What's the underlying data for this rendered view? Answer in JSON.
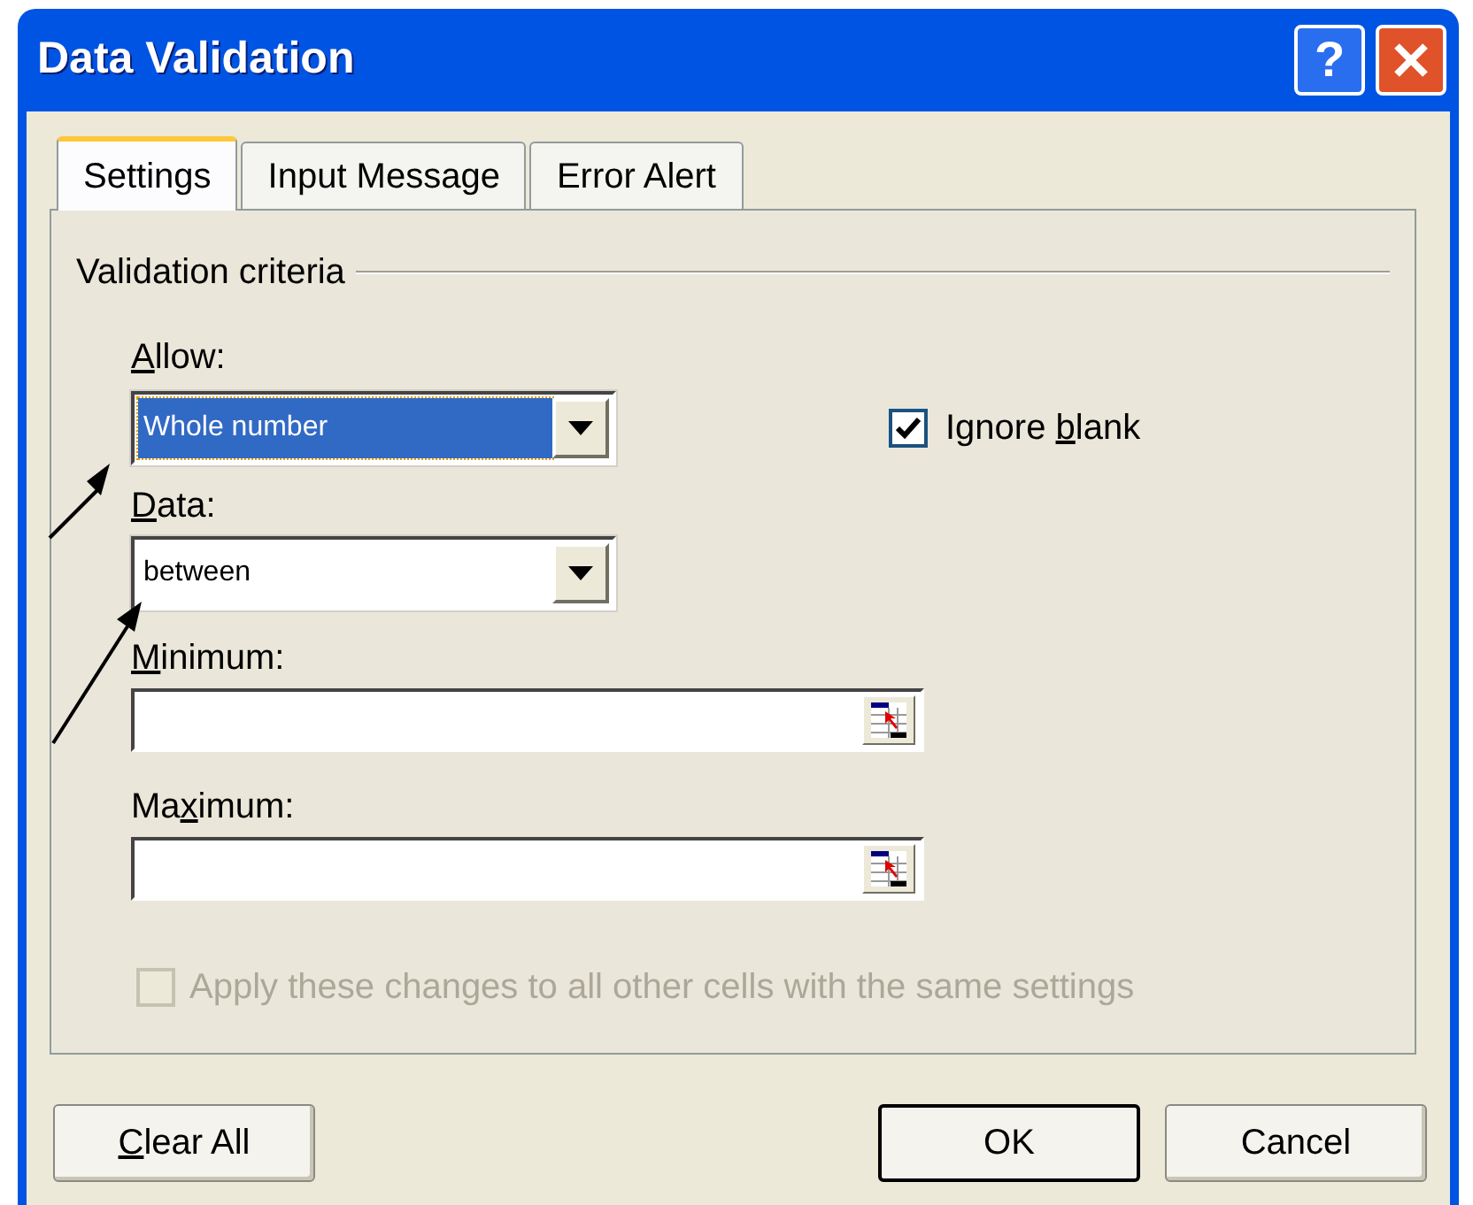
{
  "window": {
    "title": "Data Validation",
    "help_button": "?"
  },
  "tabs": [
    {
      "label": "Settings",
      "selected": true
    },
    {
      "label": "Input Message",
      "selected": false
    },
    {
      "label": "Error Alert",
      "selected": false
    }
  ],
  "criteria": {
    "title": "Validation criteria",
    "allow": {
      "label": [
        {
          "text": "A",
          "underlined": true
        },
        {
          "text": "llow:",
          "underlined": false
        }
      ],
      "value": "Whole number",
      "focused": true
    },
    "ignore_blank": {
      "label": [
        {
          "text": "Ignore ",
          "underlined": false
        },
        {
          "text": "b",
          "underlined": true
        },
        {
          "text": "lank",
          "underlined": false
        }
      ],
      "checked": true
    },
    "data": {
      "label": [
        {
          "text": "D",
          "underlined": true
        },
        {
          "text": "ata:",
          "underlined": false
        }
      ],
      "value": "between",
      "focused": false
    },
    "minimum": {
      "label": [
        {
          "text": "M",
          "underlined": true
        },
        {
          "text": "inimum:",
          "underlined": false
        }
      ]
    },
    "maximum": {
      "label": [
        {
          "text": "Ma",
          "underlined": false
        },
        {
          "text": "x",
          "underlined": true
        },
        {
          "text": "imum:",
          "underlined": false
        }
      ]
    }
  },
  "apply_all": {
    "label": "Apply these changes to all other cells with the same settings",
    "checked": false,
    "disabled": true
  },
  "buttons_left": [
    {
      "label": [
        {
          "text": "C",
          "underlined": true
        },
        {
          "text": "lear All",
          "underlined": false
        }
      ],
      "default": false
    }
  ],
  "buttons_right": [
    {
      "label": [
        {
          "text": "OK",
          "underlined": false
        }
      ],
      "default": true
    },
    {
      "label": [
        {
          "text": "Cancel",
          "underlined": false
        }
      ],
      "default": false
    }
  ]
}
